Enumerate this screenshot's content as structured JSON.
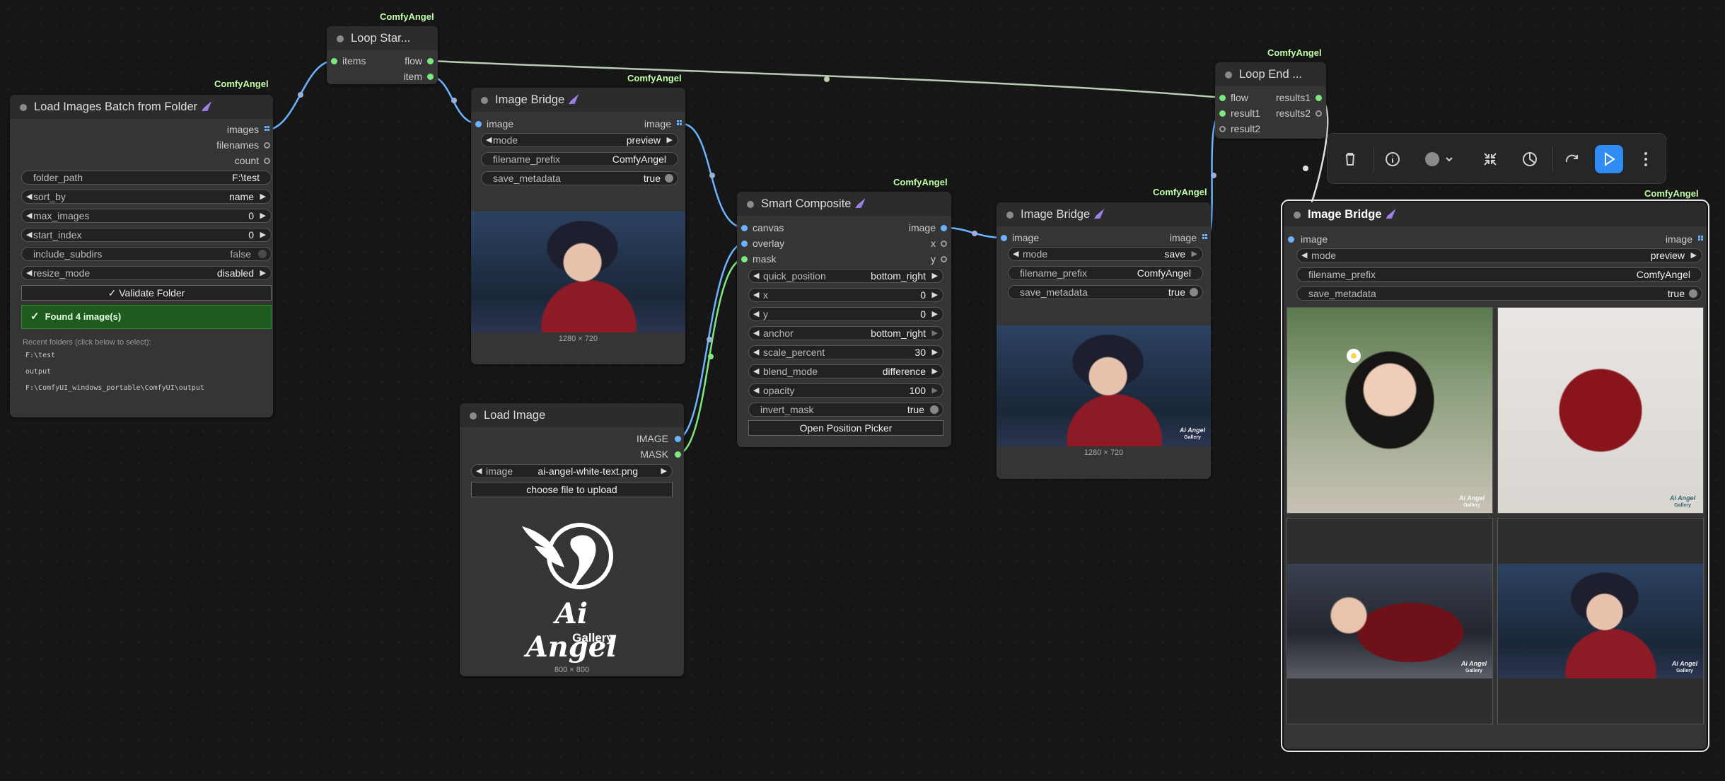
{
  "badge": "ComfyAngel",
  "load_batch": {
    "title": "Load Images Batch from Folder",
    "outputs": [
      "images",
      "filenames",
      "count"
    ],
    "widgets": [
      {
        "label": "folder_path",
        "value": "F:\\test"
      },
      {
        "label": "sort_by",
        "value": "name"
      },
      {
        "label": "max_images",
        "value": "0"
      },
      {
        "label": "start_index",
        "value": "0"
      },
      {
        "label": "include_subdirs",
        "value": "false"
      },
      {
        "label": "resize_mode",
        "value": "disabled"
      }
    ],
    "validate_label": "✓ Validate Folder",
    "status": "Found 4 image(s)",
    "recent_title": "Recent folders (click below to select):",
    "recent": [
      "F:\\test",
      "output",
      "F:\\ComfyUI_windows_portable\\ComfyUI\\output"
    ]
  },
  "loop_start": {
    "title": "Loop Star...",
    "input": "items",
    "outputs": [
      "flow",
      "item"
    ]
  },
  "bridge1": {
    "title": "Image Bridge",
    "input": "image",
    "output": "image",
    "widgets": [
      {
        "label": "mode",
        "value": "preview"
      },
      {
        "label": "filename_prefix",
        "value": "ComfyAngel"
      },
      {
        "label": "save_metadata",
        "value": "true"
      }
    ],
    "dims": "1280 × 720"
  },
  "load_image": {
    "title": "Load Image",
    "outputs": [
      "IMAGE",
      "MASK"
    ],
    "image_widget": {
      "label": "image",
      "value": "ai-angel-white-text.png"
    },
    "upload_label": "choose file to upload",
    "logo_text": "Ai Angel",
    "logo_sub": "Gallery",
    "dims": "800 × 800"
  },
  "smart_composite": {
    "title": "Smart Composite",
    "inputs": [
      "canvas",
      "overlay",
      "mask"
    ],
    "outputs": [
      "image",
      "x",
      "y"
    ],
    "widgets": [
      {
        "label": "quick_position",
        "value": "bottom_right"
      },
      {
        "label": "x",
        "value": "0"
      },
      {
        "label": "y",
        "value": "0"
      },
      {
        "label": "anchor",
        "value": "bottom_right"
      },
      {
        "label": "scale_percent",
        "value": "30"
      },
      {
        "label": "blend_mode",
        "value": "difference"
      },
      {
        "label": "opacity",
        "value": "100"
      },
      {
        "label": "invert_mask",
        "value": "true"
      }
    ],
    "button": "Open Position Picker"
  },
  "bridge2": {
    "title": "Image Bridge",
    "input": "image",
    "output": "image",
    "widgets": [
      {
        "label": "mode",
        "value": "save"
      },
      {
        "label": "filename_prefix",
        "value": "ComfyAngel"
      },
      {
        "label": "save_metadata",
        "value": "true"
      }
    ],
    "dims": "1280 × 720"
  },
  "loop_end": {
    "title": "Loop End ...",
    "inputs": [
      "flow",
      "result1",
      "result2"
    ],
    "outputs": [
      "results1",
      "results2"
    ]
  },
  "bridge3": {
    "title": "Image Bridge",
    "input": "image",
    "output": "image",
    "widgets": [
      {
        "label": "mode",
        "value": "preview"
      },
      {
        "label": "filename_prefix",
        "value": "ComfyAngel"
      },
      {
        "label": "save_metadata",
        "value": "true"
      }
    ]
  },
  "watermark": {
    "text": "Ai Angel",
    "sub": "Gallery"
  },
  "toolbar": {
    "icons": [
      "trash-icon",
      "info-icon",
      "color-icon",
      "chevron-down-icon",
      "collapse-icon",
      "bypass-icon",
      "redo-icon",
      "run-icon",
      "more-icon"
    ],
    "accent": "#2f8cf5"
  },
  "colors": {
    "link_image": "#6bb4ff",
    "link_flow": "#b9cdb3",
    "badge": "#bfffa8",
    "status_bg": "#1f5a1f"
  }
}
